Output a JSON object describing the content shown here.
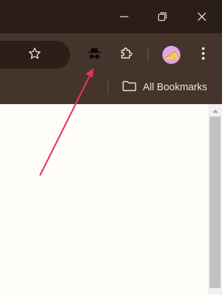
{
  "window_controls": {
    "minimize_icon": "minimize-icon",
    "restore_icon": "restore-icon",
    "close_icon": "close-icon"
  },
  "toolbar": {
    "bookmark_star_icon": "star-icon",
    "incognito_icon": "incognito-icon",
    "extensions_icon": "puzzle-icon",
    "profile_icon": "avatar",
    "menu_icon": "kebab-menu-icon"
  },
  "bookmarks_bar": {
    "all_bookmarks_label": "All Bookmarks",
    "folder_icon": "folder-icon"
  },
  "annotation": {
    "arrow_color": "#e8325f",
    "points_to": "incognito-icon"
  },
  "colors": {
    "titlebar": "#2b1e17",
    "toolbar": "#45342b",
    "omnibox": "#2c1f18",
    "page_background": "#fffdf8",
    "avatar_background": "#e0a6e4"
  }
}
